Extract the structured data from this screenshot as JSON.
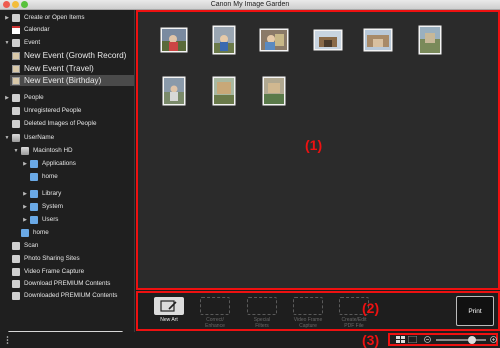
{
  "window": {
    "title": "Canon My Image Garden"
  },
  "sidebar": {
    "items": [
      {
        "label": "Create or Open Items"
      },
      {
        "label": "Calendar"
      },
      {
        "label": "Event"
      },
      {
        "label": "New Event (Growth Record)"
      },
      {
        "label": "New Event (Travel)"
      },
      {
        "label": "New Event (Birthday)"
      },
      {
        "label": "People"
      },
      {
        "label": "Unregistered People"
      },
      {
        "label": "Deleted Images of People"
      },
      {
        "label": "UserName"
      },
      {
        "label": "Macintosh HD"
      },
      {
        "label": "Applications"
      },
      {
        "label": "home"
      },
      {
        "label": "Library"
      },
      {
        "label": "System"
      },
      {
        "label": "Users"
      },
      {
        "label": "home"
      },
      {
        "label": "Scan"
      },
      {
        "label": "Photo Sharing Sites"
      },
      {
        "label": "Video Frame Capture"
      },
      {
        "label": "Download PREMIUM Contents"
      },
      {
        "label": "Downloaded PREMIUM Contents"
      }
    ]
  },
  "callouts": {
    "area1": "(1)",
    "area2": "(2)",
    "area3": "(3)"
  },
  "toolbar": {
    "new_art": "New Art",
    "correct_enhance": "Correct/\nEnhance",
    "special_filters": "Special\nFilters",
    "video_frame_capture": "Video Frame\nCapture",
    "create_edit_pdf": "Create/Edit\nPDF File",
    "print": "Print"
  },
  "colors": {
    "highlight": "#ee1111",
    "background": "#2b2b2b",
    "selected_row": "#4a4a4a"
  }
}
